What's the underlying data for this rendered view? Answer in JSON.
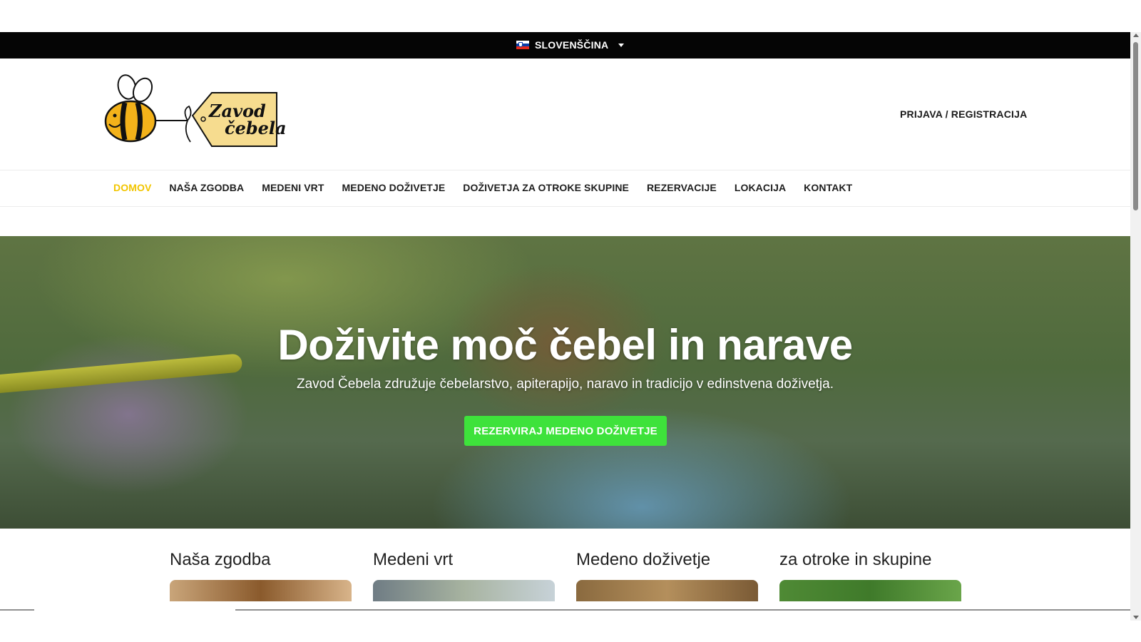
{
  "topbar": {
    "language": "SLOVENŠČINA",
    "flag_icon": "slovenia-flag-icon"
  },
  "header": {
    "logo_text_line1": "Zavod",
    "logo_text_line2": "čebela",
    "login": "PRIJAVA / REGISTRACIJA"
  },
  "nav": {
    "items": [
      {
        "label": "DOMOV",
        "active": true
      },
      {
        "label": "NAŠA ZGODBA"
      },
      {
        "label": "MEDENI VRT"
      },
      {
        "label": "MEDENO DOŽIVETJE"
      },
      {
        "label": "DOŽIVETJA ZA OTROKE SKUPINE"
      },
      {
        "label": "REZERVACIJE"
      },
      {
        "label": "LOKACIJA"
      },
      {
        "label": "KONTAKT"
      }
    ],
    "active_color": "#f2c500"
  },
  "hero": {
    "title": "Doživite moč čebel in narave",
    "subtitle": "Zavod Čebela združuje čebelarstvo, apiterapijo, naravo in tradicijo v edinstvena doživetja.",
    "cta": "REZERVIRAJ MEDENO DOŽIVETJE",
    "cta_color": "#3ee23b"
  },
  "cards": [
    {
      "title": "Naša zgodba"
    },
    {
      "title": "Medeni vrt"
    },
    {
      "title": "Medeno doživetje"
    },
    {
      "title": "za otroke in skupine"
    }
  ]
}
